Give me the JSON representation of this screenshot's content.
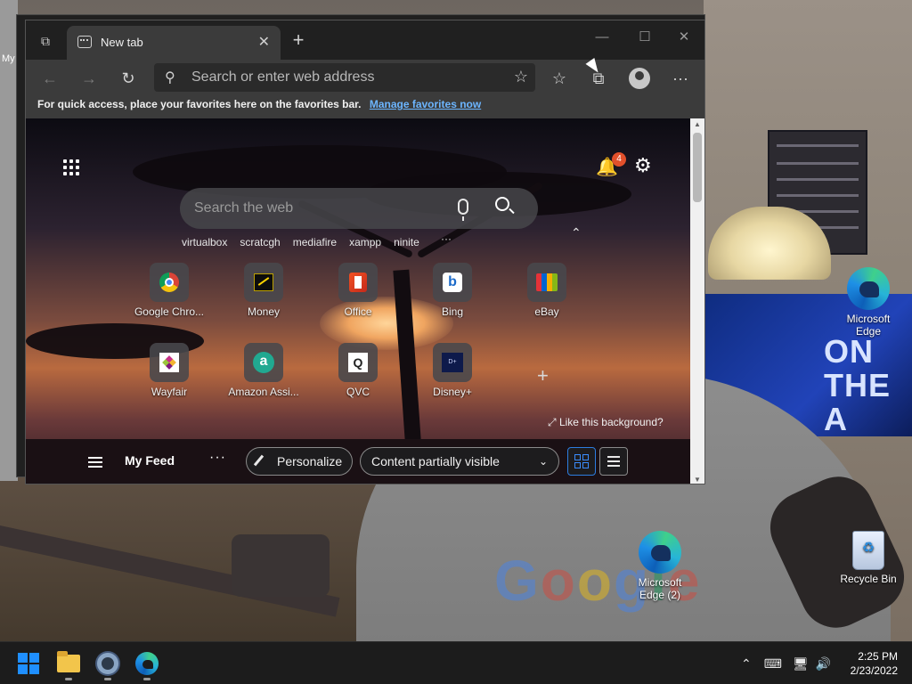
{
  "desktop": {
    "left_label": "My",
    "icons": [
      {
        "label": "Microsoft Edge"
      },
      {
        "label": "Microsoft Edge (2)"
      },
      {
        "label": "Recycle Bin"
      }
    ],
    "background_text": "Google",
    "screen_text": "ON THE A"
  },
  "browser": {
    "tab": {
      "title": "New tab",
      "close": "✕"
    },
    "new_tab": "+",
    "window_controls": {
      "minimize": "—",
      "maximize": "☐",
      "close": "✕"
    },
    "toolbar": {
      "back": "←",
      "forward": "→",
      "refresh": "↻",
      "address_placeholder": "Search or enter web address",
      "add_favorite": "☆",
      "favorites": "☆",
      "collections": "⧉",
      "more": "···"
    },
    "favorites_bar": {
      "text": "For quick access, place your favorites here on the favorites bar.",
      "link": "Manage favorites now"
    }
  },
  "new_tab_page": {
    "notifications_count": "4",
    "search_placeholder": "Search the web",
    "quick_links": [
      "virtualbox",
      "scratcgh",
      "mediafire",
      "xampp",
      "ninite"
    ],
    "quick_links_more": "···",
    "collapse": "⌃",
    "tiles": [
      {
        "label": "Google Chro...",
        "icon": "chrome-icon"
      },
      {
        "label": "Money",
        "icon": "money-icon"
      },
      {
        "label": "Office",
        "icon": "office-icon"
      },
      {
        "label": "Bing",
        "icon": "bing-icon"
      },
      {
        "label": "eBay",
        "icon": "ebay-icon"
      },
      {
        "label": "Wayfair",
        "icon": "wayfair-icon"
      },
      {
        "label": "Amazon Assi...",
        "icon": "amazon-icon"
      },
      {
        "label": "QVC",
        "icon": "qvc-icon"
      },
      {
        "label": "Disney+",
        "icon": "disney-icon"
      }
    ],
    "add_tile": "+",
    "like_background": "Like this background?",
    "feed": {
      "title": "My Feed",
      "more": "···",
      "personalize": "Personalize",
      "content_visibility": "Content partially visible"
    }
  },
  "taskbar": {
    "tray_chevron": "⌃",
    "time": "2:25 PM",
    "date": "2/23/2022"
  },
  "colors": {
    "accent": "#2d7de0",
    "link": "#6cb5ff",
    "badge": "#e2502b",
    "taskbar": "#1c1c1c"
  }
}
